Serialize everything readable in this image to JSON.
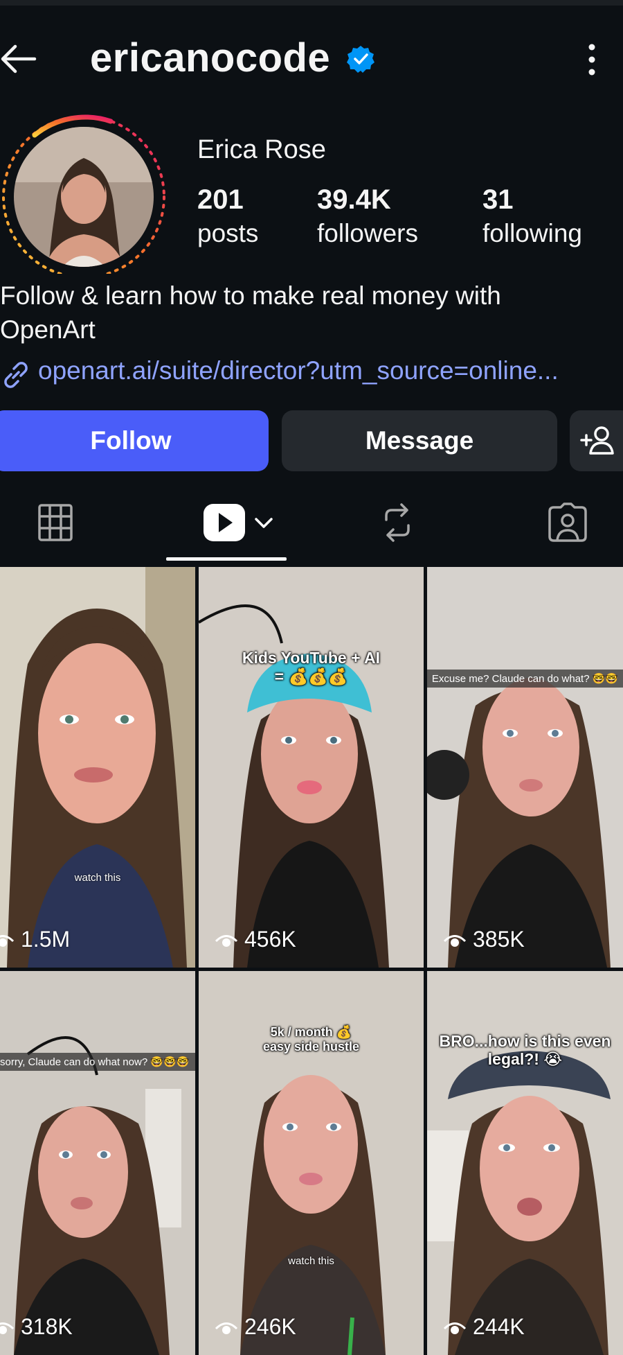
{
  "header": {
    "username": "ericanocode",
    "verified": true
  },
  "profile": {
    "display_name": "Erica Rose",
    "stats": [
      {
        "value": "201",
        "label": "posts"
      },
      {
        "value": "39.4K",
        "label": "followers"
      },
      {
        "value": "31",
        "label": "following"
      }
    ],
    "bio_line1": "Follow & learn how to make real money with",
    "bio_line2": "OpenArt",
    "link": "openart.ai/suite/director?utm_source=online..."
  },
  "buttons": {
    "follow": "Follow",
    "message": "Message"
  },
  "tabs": [
    {
      "icon": "grid-icon",
      "active": false
    },
    {
      "icon": "reels-icon",
      "active": true
    },
    {
      "icon": "reposts-icon",
      "active": false
    },
    {
      "icon": "tagged-icon",
      "active": false
    }
  ],
  "reels": [
    {
      "views": "1.5M",
      "caption": "",
      "subtitle": "watch this"
    },
    {
      "views": "456K",
      "caption": "Kids YouTube + AI\n= 💰💰💰",
      "subtitle": ""
    },
    {
      "views": "385K",
      "caption_bar": "Excuse me? Claude can do what? 🤓🤓",
      "subtitle": ""
    },
    {
      "views": "318K",
      "caption_bar": "sorry, Claude can do what now? 🤓🤓🤓",
      "subtitle": ""
    },
    {
      "views": "246K",
      "caption": "5k / month 💰\neasy side hustle",
      "subtitle": "watch this"
    },
    {
      "views": "244K",
      "caption": "BRO...how is this even\nlegal?! 😭",
      "subtitle": ""
    }
  ],
  "colors": {
    "background": "#0c1014",
    "follow_button": "#4a5df9",
    "secondary_button": "#25292e",
    "link": "#8fa3ff",
    "verified": "#0095f6"
  }
}
